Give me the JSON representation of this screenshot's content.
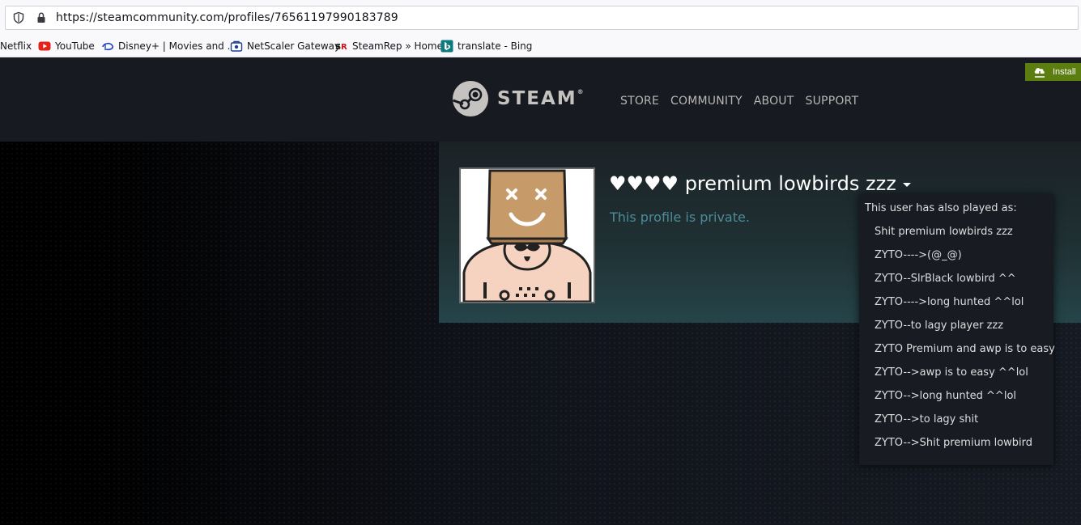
{
  "browser": {
    "url": "https://steamcommunity.com/profiles/76561197990183789",
    "bookmarks": [
      {
        "label": "Netflix",
        "icon": "none"
      },
      {
        "label": "YouTube",
        "icon": "youtube-icon"
      },
      {
        "label": "Disney+ | Movies and ...",
        "icon": "disney-icon"
      },
      {
        "label": "NetScaler Gateway",
        "icon": "netscaler-icon"
      },
      {
        "label": "SteamRep » Home",
        "icon": "steamrep-icon"
      },
      {
        "label": "translate - Bing",
        "icon": "bing-icon"
      }
    ]
  },
  "header": {
    "logo_text": "STEAM",
    "nav": [
      "STORE",
      "COMMUNITY",
      "ABOUT",
      "SUPPORT"
    ],
    "install_label": "Install",
    "install_color": "#5c7e10"
  },
  "profile": {
    "persona_name": "♥♥♥♥ premium lowbirds zzz",
    "private_message": "This profile is private.",
    "private_color": "#4d8b9b"
  },
  "aliases": {
    "heading": "This user has also played as:",
    "items": [
      "Shit premium lowbirds zzz",
      "ZYTO---->(@_@)",
      "ZYTO--SlrBlack lowbird ^^",
      "ZYTO---->long hunted ^^lol",
      "ZYTO--to lagy player zzz",
      "ZYTO Premium and awp is to easy",
      "ZYTO-->awp is to easy ^^lol",
      "ZYTO-->long hunted ^^lol",
      "ZYTO-->to lagy shit",
      "ZYTO-->Shit premium lowbird"
    ]
  }
}
